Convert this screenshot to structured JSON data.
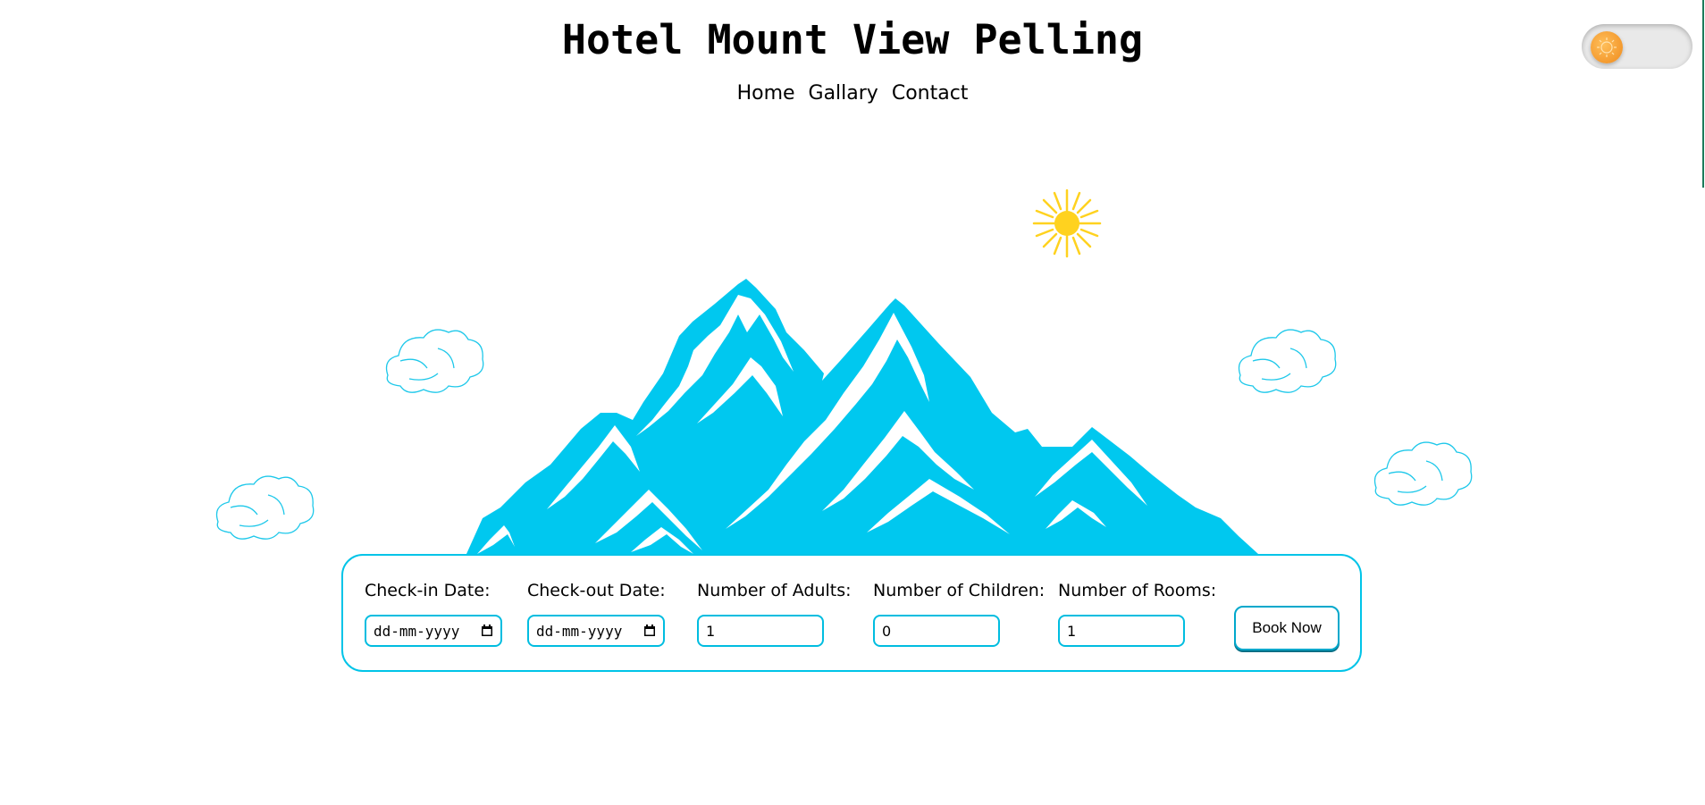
{
  "header": {
    "title": "Hotel Mount View Pelling",
    "nav": [
      {
        "label": "Home"
      },
      {
        "label": "Gallary"
      },
      {
        "label": "Contact"
      }
    ]
  },
  "theme_toggle": {
    "icon": "sun-icon",
    "state": "light"
  },
  "colors": {
    "accent": "#00c4e8",
    "mountain": "#00c8ef",
    "sun": "#ffd21f",
    "toggle_knob": "#f29a2e"
  },
  "booking": {
    "checkin": {
      "label": "Check-in Date:",
      "placeholder": "dd-mm-yyyy"
    },
    "checkout": {
      "label": "Check-out Date:",
      "placeholder": "dd-mm-yyyy"
    },
    "adults": {
      "label": "Number of Adults:",
      "value": "1"
    },
    "children": {
      "label": "Number of Children:",
      "value": "0"
    },
    "rooms": {
      "label": "Number of Rooms:",
      "value": "1"
    },
    "submit_label": "Book Now"
  }
}
